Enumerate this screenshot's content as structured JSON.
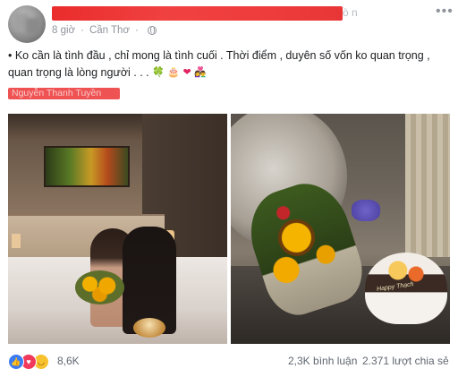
{
  "post": {
    "author": {
      "name_tail": "ồ n",
      "redacted": true
    },
    "time": "8 giờ",
    "location": "Cần Thơ",
    "privacy": "globe-icon",
    "text": "• Ko cần là tình đầu , chỉ mong là tình cuối . Thời điểm , duyên số vốn ko quan trọng , quan trọng là lòng người . . .",
    "emojis": [
      "🍀",
      "🎂",
      "❤",
      "👩‍❤️‍👨"
    ],
    "tagged_name": "Nguyễn Thanh Tuyền",
    "cake_label": "Happy Thạch"
  },
  "footer": {
    "reaction_count": "8,6K",
    "comments": "2,3K bình luận",
    "shares": "2.371 lượt chia sẻ"
  },
  "colors": {
    "redaction": "#ef3c3c",
    "meta_text": "#90949c",
    "like": "#3b7cf5",
    "love": "#f0395b",
    "haha": "#f7c22e"
  }
}
